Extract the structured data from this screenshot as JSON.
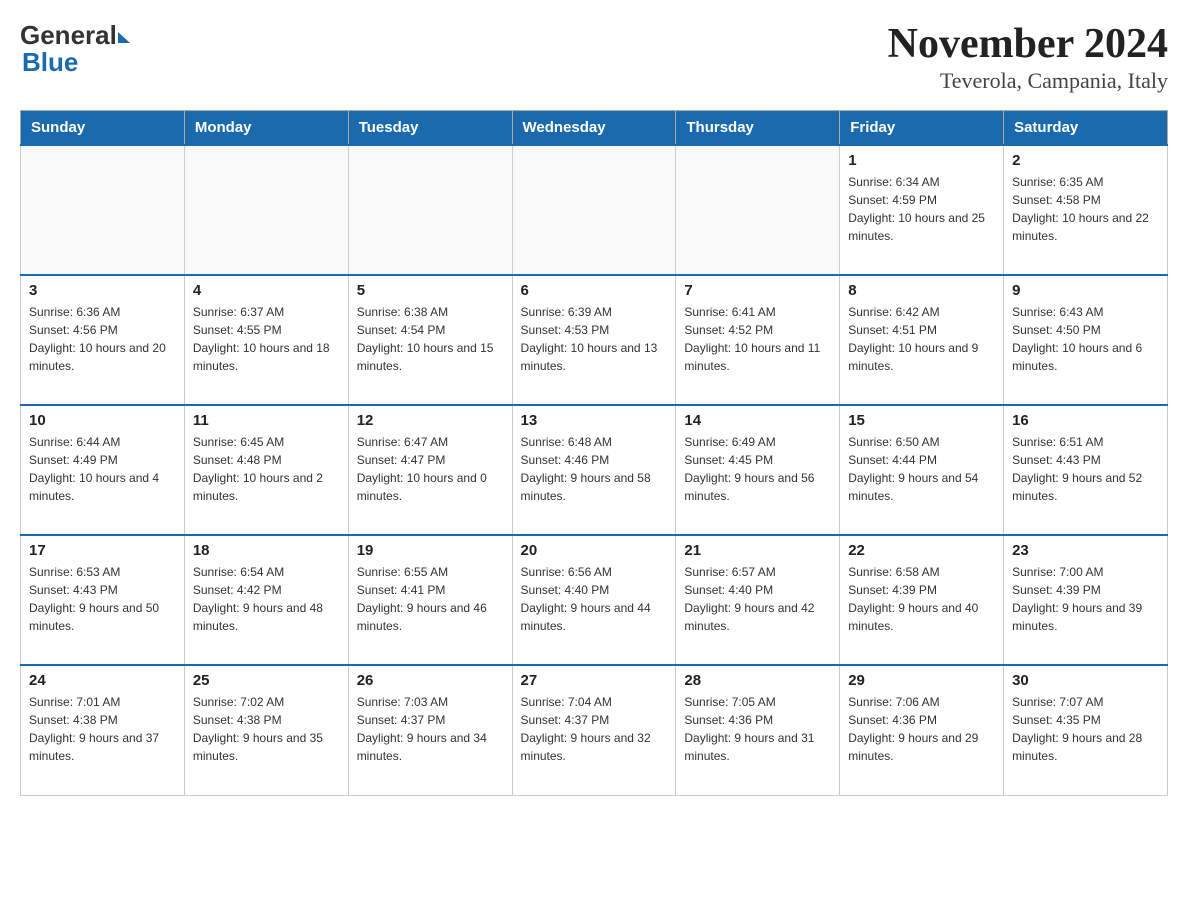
{
  "header": {
    "title": "November 2024",
    "subtitle": "Teverola, Campania, Italy"
  },
  "days_of_week": [
    "Sunday",
    "Monday",
    "Tuesday",
    "Wednesday",
    "Thursday",
    "Friday",
    "Saturday"
  ],
  "weeks": [
    [
      {
        "day": "",
        "info": ""
      },
      {
        "day": "",
        "info": ""
      },
      {
        "day": "",
        "info": ""
      },
      {
        "day": "",
        "info": ""
      },
      {
        "day": "",
        "info": ""
      },
      {
        "day": "1",
        "info": "Sunrise: 6:34 AM\nSunset: 4:59 PM\nDaylight: 10 hours and 25 minutes."
      },
      {
        "day": "2",
        "info": "Sunrise: 6:35 AM\nSunset: 4:58 PM\nDaylight: 10 hours and 22 minutes."
      }
    ],
    [
      {
        "day": "3",
        "info": "Sunrise: 6:36 AM\nSunset: 4:56 PM\nDaylight: 10 hours and 20 minutes."
      },
      {
        "day": "4",
        "info": "Sunrise: 6:37 AM\nSunset: 4:55 PM\nDaylight: 10 hours and 18 minutes."
      },
      {
        "day": "5",
        "info": "Sunrise: 6:38 AM\nSunset: 4:54 PM\nDaylight: 10 hours and 15 minutes."
      },
      {
        "day": "6",
        "info": "Sunrise: 6:39 AM\nSunset: 4:53 PM\nDaylight: 10 hours and 13 minutes."
      },
      {
        "day": "7",
        "info": "Sunrise: 6:41 AM\nSunset: 4:52 PM\nDaylight: 10 hours and 11 minutes."
      },
      {
        "day": "8",
        "info": "Sunrise: 6:42 AM\nSunset: 4:51 PM\nDaylight: 10 hours and 9 minutes."
      },
      {
        "day": "9",
        "info": "Sunrise: 6:43 AM\nSunset: 4:50 PM\nDaylight: 10 hours and 6 minutes."
      }
    ],
    [
      {
        "day": "10",
        "info": "Sunrise: 6:44 AM\nSunset: 4:49 PM\nDaylight: 10 hours and 4 minutes."
      },
      {
        "day": "11",
        "info": "Sunrise: 6:45 AM\nSunset: 4:48 PM\nDaylight: 10 hours and 2 minutes."
      },
      {
        "day": "12",
        "info": "Sunrise: 6:47 AM\nSunset: 4:47 PM\nDaylight: 10 hours and 0 minutes."
      },
      {
        "day": "13",
        "info": "Sunrise: 6:48 AM\nSunset: 4:46 PM\nDaylight: 9 hours and 58 minutes."
      },
      {
        "day": "14",
        "info": "Sunrise: 6:49 AM\nSunset: 4:45 PM\nDaylight: 9 hours and 56 minutes."
      },
      {
        "day": "15",
        "info": "Sunrise: 6:50 AM\nSunset: 4:44 PM\nDaylight: 9 hours and 54 minutes."
      },
      {
        "day": "16",
        "info": "Sunrise: 6:51 AM\nSunset: 4:43 PM\nDaylight: 9 hours and 52 minutes."
      }
    ],
    [
      {
        "day": "17",
        "info": "Sunrise: 6:53 AM\nSunset: 4:43 PM\nDaylight: 9 hours and 50 minutes."
      },
      {
        "day": "18",
        "info": "Sunrise: 6:54 AM\nSunset: 4:42 PM\nDaylight: 9 hours and 48 minutes."
      },
      {
        "day": "19",
        "info": "Sunrise: 6:55 AM\nSunset: 4:41 PM\nDaylight: 9 hours and 46 minutes."
      },
      {
        "day": "20",
        "info": "Sunrise: 6:56 AM\nSunset: 4:40 PM\nDaylight: 9 hours and 44 minutes."
      },
      {
        "day": "21",
        "info": "Sunrise: 6:57 AM\nSunset: 4:40 PM\nDaylight: 9 hours and 42 minutes."
      },
      {
        "day": "22",
        "info": "Sunrise: 6:58 AM\nSunset: 4:39 PM\nDaylight: 9 hours and 40 minutes."
      },
      {
        "day": "23",
        "info": "Sunrise: 7:00 AM\nSunset: 4:39 PM\nDaylight: 9 hours and 39 minutes."
      }
    ],
    [
      {
        "day": "24",
        "info": "Sunrise: 7:01 AM\nSunset: 4:38 PM\nDaylight: 9 hours and 37 minutes."
      },
      {
        "day": "25",
        "info": "Sunrise: 7:02 AM\nSunset: 4:38 PM\nDaylight: 9 hours and 35 minutes."
      },
      {
        "day": "26",
        "info": "Sunrise: 7:03 AM\nSunset: 4:37 PM\nDaylight: 9 hours and 34 minutes."
      },
      {
        "day": "27",
        "info": "Sunrise: 7:04 AM\nSunset: 4:37 PM\nDaylight: 9 hours and 32 minutes."
      },
      {
        "day": "28",
        "info": "Sunrise: 7:05 AM\nSunset: 4:36 PM\nDaylight: 9 hours and 31 minutes."
      },
      {
        "day": "29",
        "info": "Sunrise: 7:06 AM\nSunset: 4:36 PM\nDaylight: 9 hours and 29 minutes."
      },
      {
        "day": "30",
        "info": "Sunrise: 7:07 AM\nSunset: 4:35 PM\nDaylight: 9 hours and 28 minutes."
      }
    ]
  ]
}
